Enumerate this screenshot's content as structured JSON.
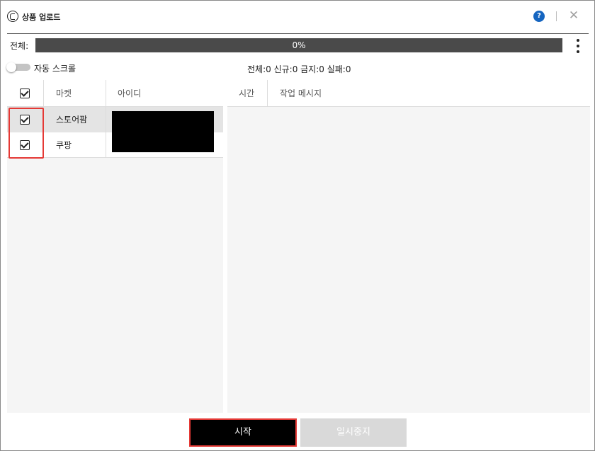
{
  "window": {
    "title": "상품 업로드",
    "help_glyph": "?",
    "close_glyph": "✕"
  },
  "overall": {
    "label": "전체:",
    "progress_text": "0%",
    "progress_value": 0
  },
  "auto_scroll": {
    "label": "자동 스크롤",
    "enabled": false
  },
  "counts_text": "전체:0 신규:0 금지:0 실패:0",
  "market_grid": {
    "columns": [
      "마켓",
      "아이디"
    ],
    "select_all_checked": true,
    "rows": [
      {
        "market": "스토어팜",
        "checked": true
      },
      {
        "market": "쿠팡",
        "checked": true
      }
    ]
  },
  "log_grid": {
    "columns": [
      "시간",
      "작업 메시지"
    ]
  },
  "buttons": {
    "start": "시작",
    "pause": "일시중지"
  },
  "colors": {
    "progress_track": "#4a4a4a",
    "help_icon": "#1565c0",
    "highlight": "#e53935",
    "start_button": "#000000",
    "pause_button_disabled": "#d9d9d9"
  }
}
